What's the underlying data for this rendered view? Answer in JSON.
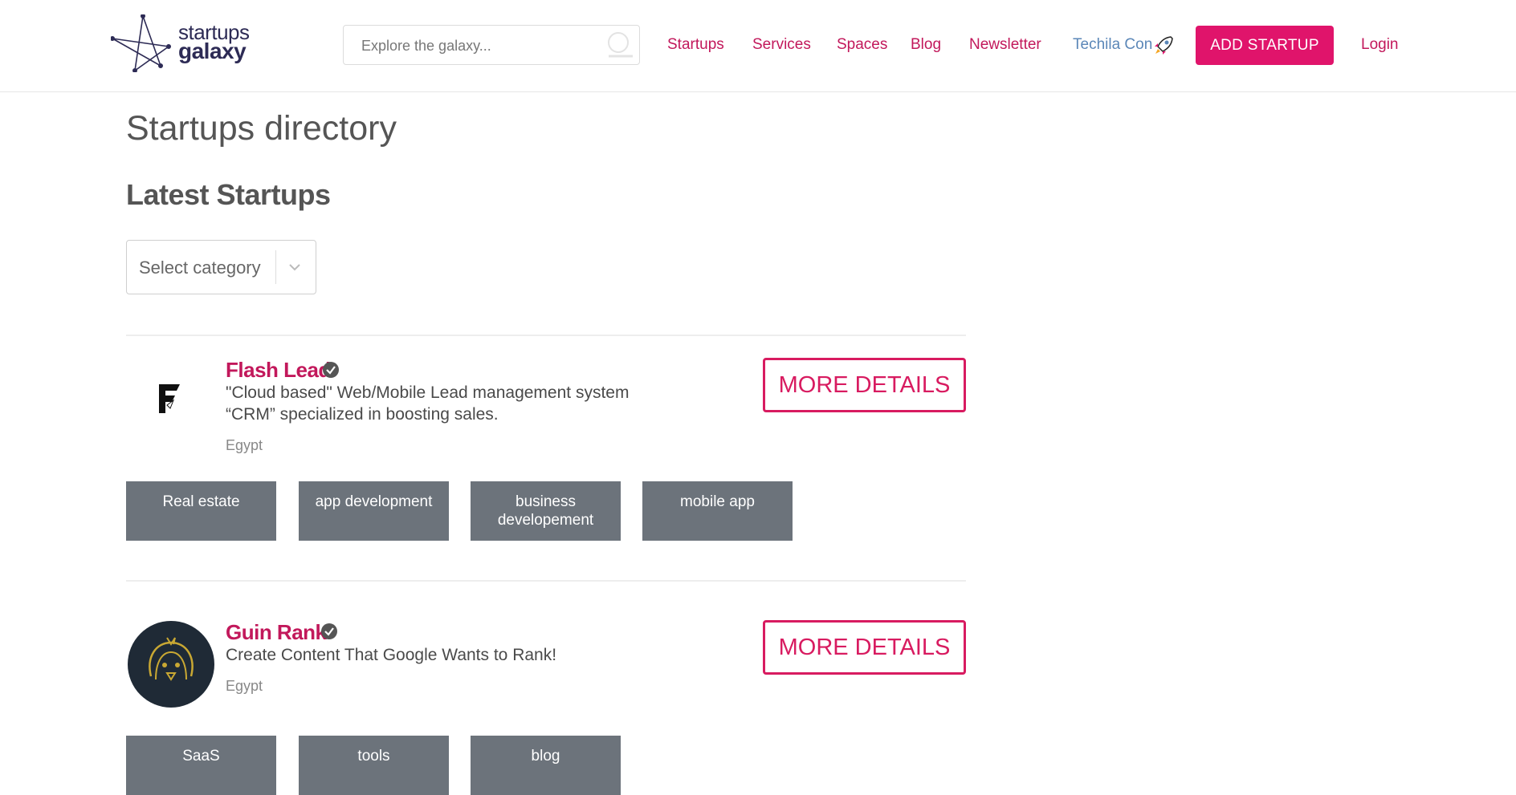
{
  "header": {
    "logo": {
      "line1": "startups",
      "line2": "galaxy"
    },
    "search_placeholder": "Explore the galaxy...",
    "nav": [
      "Startups",
      "Services",
      "Spaces",
      "Blog",
      "Newsletter",
      "Techila Con"
    ],
    "add_button": "ADD STARTUP",
    "login": "Login"
  },
  "page": {
    "title": "Startups directory",
    "section_title": "Latest Startups",
    "category_select": "Select category"
  },
  "startups": [
    {
      "name": "Flash Lead",
      "description": "\"Cloud based\" Web/Mobile Lead management system “CRM” specialized in boosting sales.",
      "country": "Egypt",
      "button": "MORE DETAILS",
      "tags": [
        "Real estate",
        "app development",
        "business developement",
        "mobile app"
      ]
    },
    {
      "name": "Guin Rank",
      "description": "Create Content That Google Wants to Rank!",
      "country": "Egypt",
      "button": "MORE DETAILS",
      "tags": [
        "SaaS",
        "tools",
        "blog"
      ]
    }
  ],
  "colors": {
    "brand": "#e0146b",
    "link": "#c2185b",
    "tag_bg": "#6c737b",
    "techila": "#5b87b8"
  }
}
